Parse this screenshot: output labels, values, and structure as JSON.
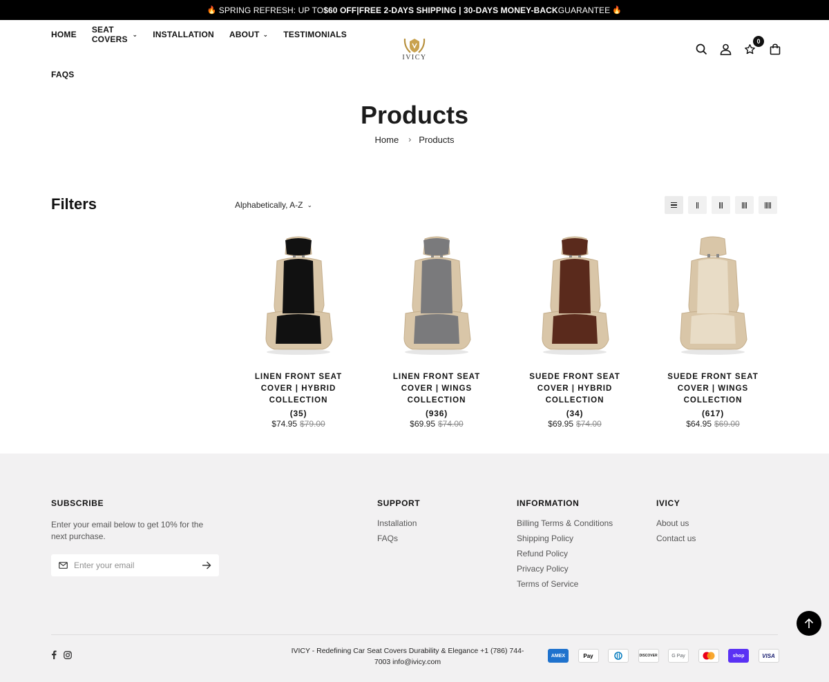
{
  "announcement": {
    "part1": "SPRING REFRESH: UP TO ",
    "bold1": "$60 OFF",
    "part2": " | ",
    "bold2": "FREE 2-DAYS SHIPPING | 30-DAYS MONEY-BACK",
    "part3": " GUARANTEE"
  },
  "nav": {
    "items": [
      {
        "label": "HOME"
      },
      {
        "label": "SEAT COVERS"
      },
      {
        "label": "INSTALLATION"
      },
      {
        "label": "ABOUT"
      },
      {
        "label": "TESTIMONIALS"
      },
      {
        "label": "FAQS"
      }
    ]
  },
  "logo": {
    "brand": "IVICY"
  },
  "header": {
    "wishlist_count": "0"
  },
  "page": {
    "title": "Products",
    "breadcrumb": [
      "Home",
      "Products"
    ]
  },
  "toolbar": {
    "filters_label": "Filters",
    "sort_value": "Alphabetically, A-Z"
  },
  "products": [
    {
      "title": "LINEN FRONT SEAT COVER | HYBRID COLLECTION",
      "reviews": "(35)",
      "price": "$74.95",
      "compare_price": "$79.00",
      "color": "#111111"
    },
    {
      "title": "LINEN FRONT SEAT COVER | WINGS COLLECTION",
      "reviews": "(936)",
      "price": "$69.95",
      "compare_price": "$74.00",
      "color": "#7a7a7c"
    },
    {
      "title": "SUEDE FRONT SEAT COVER | HYBRID COLLECTION",
      "reviews": "(34)",
      "price": "$69.95",
      "compare_price": "$74.00",
      "color": "#5a2a1c"
    },
    {
      "title": "SUEDE FRONT SEAT COVER | WINGS COLLECTION",
      "reviews": "(617)",
      "price": "$64.95",
      "compare_price": "$69.00",
      "color": "#e8dcc6"
    }
  ],
  "footer": {
    "subscribe": {
      "heading": "SUBSCRIBE",
      "text": "Enter your email below to get 10% for the next purchase.",
      "placeholder": "Enter your email"
    },
    "support": {
      "heading": "SUPPORT",
      "links": [
        "Installation",
        "FAQs"
      ]
    },
    "information": {
      "heading": "INFORMATION",
      "links": [
        "Billing Terms & Conditions",
        "Shipping Policy",
        "Refund Policy",
        "Privacy Policy",
        "Terms of Service"
      ]
    },
    "ivicy": {
      "heading": "IVICY",
      "links": [
        "About us",
        "Contact us"
      ]
    },
    "copyright": "IVICY - Redefining Car Seat Covers Durability & Elegance +1 (786) 744-7003 info@ivicy.com",
    "payments": [
      "AMEX",
      "Pay",
      "Diners",
      "DISCOVER",
      "G Pay",
      "Mastercard",
      "shop",
      "VISA"
    ]
  }
}
